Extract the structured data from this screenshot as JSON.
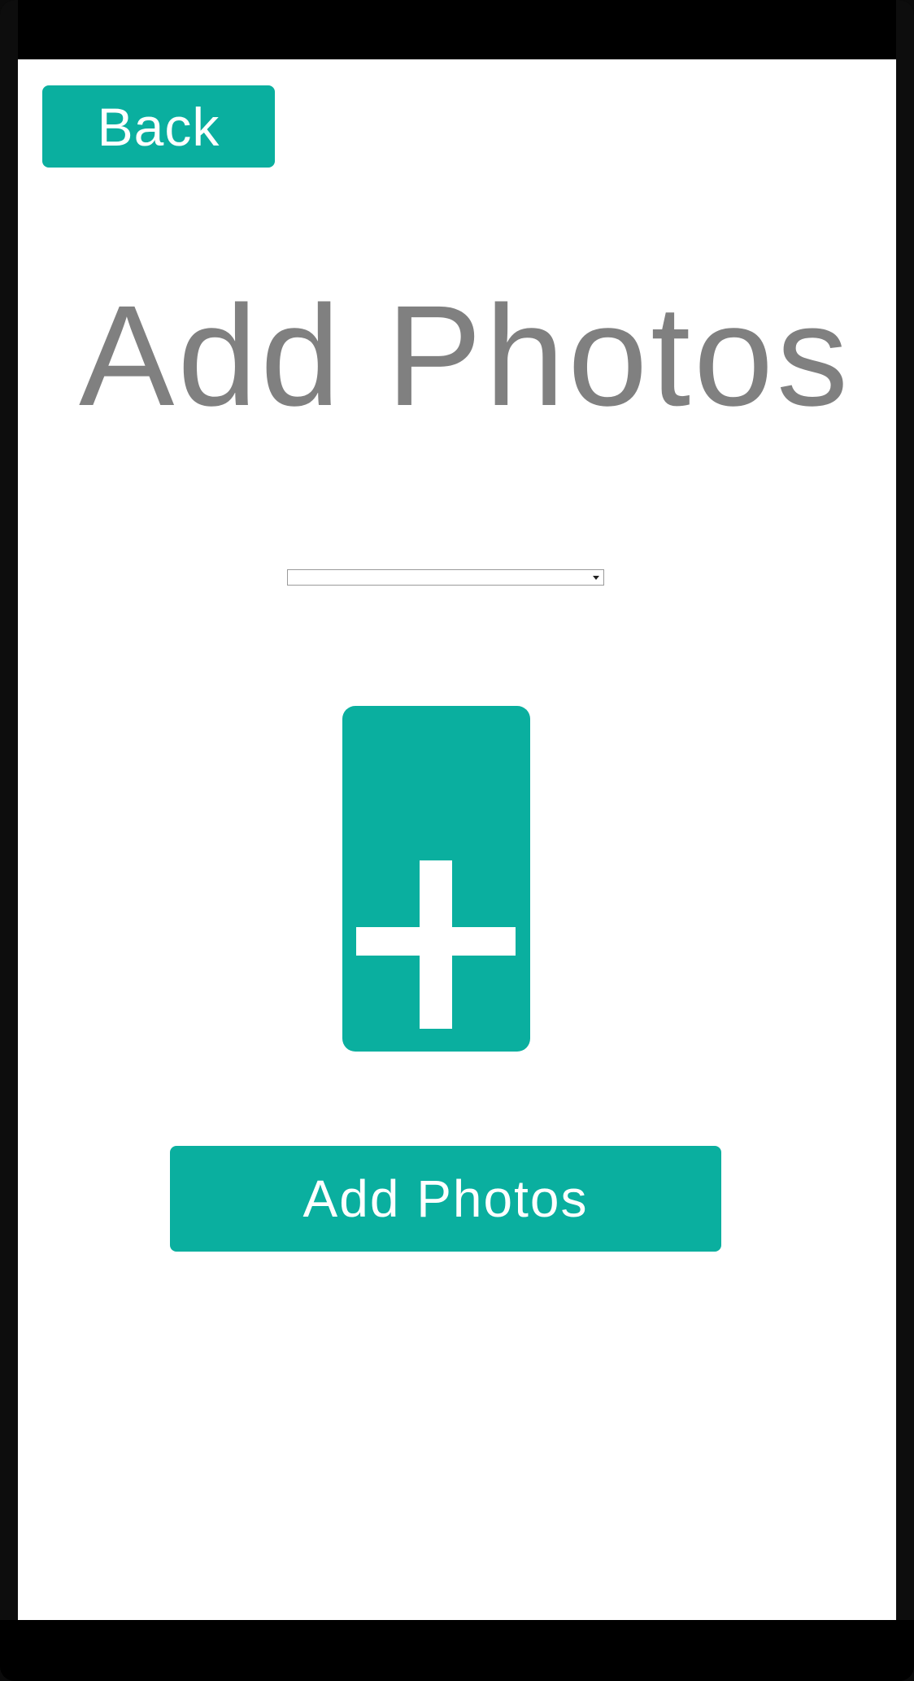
{
  "header": {
    "back_label": "Back"
  },
  "main": {
    "title": "Add Photos",
    "select_value": "",
    "add_button_label": "Add Photos"
  },
  "colors": {
    "accent": "#0aaf9f",
    "title_text": "#808080",
    "background": "#ffffff"
  },
  "icons": {
    "add_tile_icon": "plus-icon",
    "select_caret": "chevron-down-icon"
  }
}
